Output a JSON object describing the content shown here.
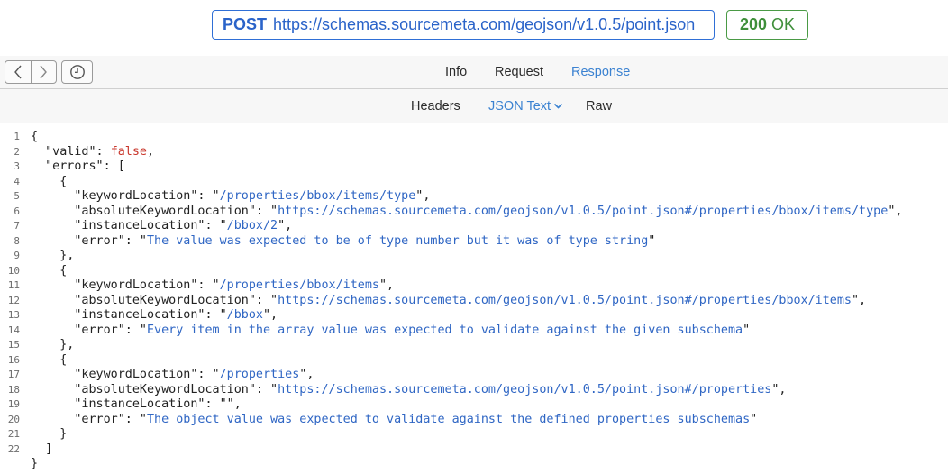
{
  "request": {
    "method": "POST",
    "url": "https://schemas.sourcemeta.com/geojson/v1.0.5/point.json"
  },
  "status": {
    "code": "200",
    "text": "OK"
  },
  "nav": {
    "back_icon": "chevron-left-icon",
    "forward_icon": "chevron-right-icon",
    "history_icon": "clock-icon"
  },
  "tabs": [
    {
      "label": "Info",
      "active": false
    },
    {
      "label": "Request",
      "active": false
    },
    {
      "label": "Response",
      "active": true
    }
  ],
  "subtabs": [
    {
      "label": "Headers",
      "active": false
    },
    {
      "label": "JSON Text",
      "active": true,
      "dropdown": true
    },
    {
      "label": "Raw",
      "active": false
    }
  ],
  "colors": {
    "accent": "#3b82d1",
    "url_border": "#2f6fd6",
    "status_green": "#3f8f3a",
    "string": "#2f66c4",
    "keyword": "#c9372c"
  },
  "code": {
    "line_numbers": [
      "1",
      "2",
      "3",
      "4",
      "5",
      "6",
      "7",
      "8",
      "9",
      "10",
      "11",
      "12",
      "13",
      "14",
      "15",
      "16",
      "17",
      "18",
      "19",
      "20",
      "21",
      "22"
    ],
    "lines": [
      [
        {
          "t": "p",
          "v": "{"
        }
      ],
      [
        {
          "t": "p",
          "v": "  \"valid\": "
        },
        {
          "t": "k",
          "v": "false"
        },
        {
          "t": "p",
          "v": ","
        }
      ],
      [
        {
          "t": "p",
          "v": "  \"errors\": ["
        }
      ],
      [
        {
          "t": "p",
          "v": "    {"
        }
      ],
      [
        {
          "t": "p",
          "v": "      \"keywordLocation\": \""
        },
        {
          "t": "s",
          "v": "/properties/bbox/items/type"
        },
        {
          "t": "p",
          "v": "\","
        }
      ],
      [
        {
          "t": "p",
          "v": "      \"absoluteKeywordLocation\": \""
        },
        {
          "t": "s",
          "v": "https://schemas.sourcemeta.com/geojson/v1.0.5/point.json#/properties/bbox/items/type"
        },
        {
          "t": "p",
          "v": "\","
        }
      ],
      [
        {
          "t": "p",
          "v": "      \"instanceLocation\": \""
        },
        {
          "t": "s",
          "v": "/bbox/2"
        },
        {
          "t": "p",
          "v": "\","
        }
      ],
      [
        {
          "t": "p",
          "v": "      \"error\": \""
        },
        {
          "t": "s",
          "v": "The value was expected to be of type number but it was of type string"
        },
        {
          "t": "p",
          "v": "\""
        }
      ],
      [
        {
          "t": "p",
          "v": "    },"
        }
      ],
      [
        {
          "t": "p",
          "v": "    {"
        }
      ],
      [
        {
          "t": "p",
          "v": "      \"keywordLocation\": \""
        },
        {
          "t": "s",
          "v": "/properties/bbox/items"
        },
        {
          "t": "p",
          "v": "\","
        }
      ],
      [
        {
          "t": "p",
          "v": "      \"absoluteKeywordLocation\": \""
        },
        {
          "t": "s",
          "v": "https://schemas.sourcemeta.com/geojson/v1.0.5/point.json#/properties/bbox/items"
        },
        {
          "t": "p",
          "v": "\","
        }
      ],
      [
        {
          "t": "p",
          "v": "      \"instanceLocation\": \""
        },
        {
          "t": "s",
          "v": "/bbox"
        },
        {
          "t": "p",
          "v": "\","
        }
      ],
      [
        {
          "t": "p",
          "v": "      \"error\": \""
        },
        {
          "t": "s",
          "v": "Every item in the array value was expected to validate against the given subschema"
        },
        {
          "t": "p",
          "v": "\""
        }
      ],
      [
        {
          "t": "p",
          "v": "    },"
        }
      ],
      [
        {
          "t": "p",
          "v": "    {"
        }
      ],
      [
        {
          "t": "p",
          "v": "      \"keywordLocation\": \""
        },
        {
          "t": "s",
          "v": "/properties"
        },
        {
          "t": "p",
          "v": "\","
        }
      ],
      [
        {
          "t": "p",
          "v": "      \"absoluteKeywordLocation\": \""
        },
        {
          "t": "s",
          "v": "https://schemas.sourcemeta.com/geojson/v1.0.5/point.json#/properties"
        },
        {
          "t": "p",
          "v": "\","
        }
      ],
      [
        {
          "t": "p",
          "v": "      \"instanceLocation\": \"\","
        }
      ],
      [
        {
          "t": "p",
          "v": "      \"error\": \""
        },
        {
          "t": "s",
          "v": "The object value was expected to validate against the defined properties subschemas"
        },
        {
          "t": "p",
          "v": "\""
        }
      ],
      [
        {
          "t": "p",
          "v": "    }"
        }
      ],
      [
        {
          "t": "p",
          "v": "  ]"
        }
      ],
      [
        {
          "t": "p",
          "v": "}"
        }
      ]
    ]
  }
}
